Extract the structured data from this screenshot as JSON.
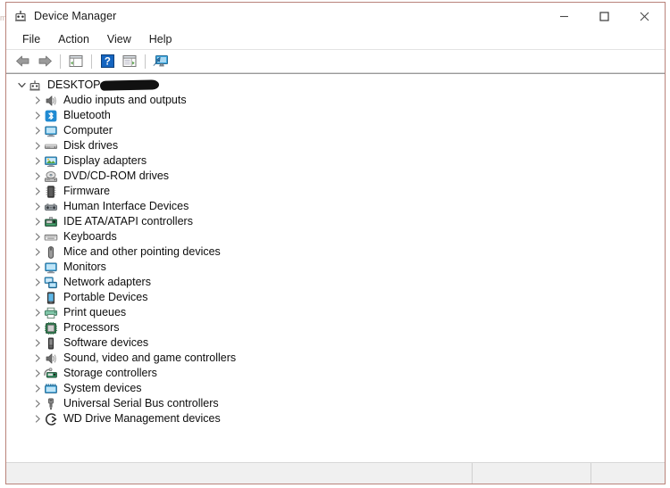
{
  "window": {
    "title": "Device Manager",
    "icon": "device-manager-icon",
    "controls": {
      "minimize": "–",
      "maximize": "☐",
      "close": "✕"
    }
  },
  "menubar": {
    "items": [
      {
        "label": "File"
      },
      {
        "label": "Action"
      },
      {
        "label": "View"
      },
      {
        "label": "Help"
      }
    ]
  },
  "toolbar": {
    "buttons": [
      {
        "name": "back-button",
        "icon": "back-arrow-icon",
        "tooltip": "Back"
      },
      {
        "name": "forward-button",
        "icon": "forward-arrow-icon",
        "tooltip": "Forward"
      },
      {
        "name": "show-hide-console-tree-button",
        "icon": "console-tree-icon",
        "tooltip": "Show/Hide Console Tree"
      },
      {
        "name": "help-button",
        "icon": "help-question-icon",
        "tooltip": "Help"
      },
      {
        "name": "properties-button",
        "icon": "properties-window-icon",
        "tooltip": "Properties"
      },
      {
        "name": "scan-hardware-changes-button",
        "icon": "scan-monitor-icon",
        "tooltip": "Scan for hardware changes"
      }
    ]
  },
  "tree": {
    "root": {
      "label": "DESKTOP",
      "redacted": true,
      "expanded": true,
      "icon": "computer-root-icon"
    },
    "items": [
      {
        "label": "Audio inputs and outputs",
        "icon": "speaker-icon"
      },
      {
        "label": "Bluetooth",
        "icon": "bluetooth-icon"
      },
      {
        "label": "Computer",
        "icon": "monitor-icon"
      },
      {
        "label": "Disk drives",
        "icon": "disk-drive-icon"
      },
      {
        "label": "Display adapters",
        "icon": "display-adapter-icon"
      },
      {
        "label": "DVD/CD-ROM drives",
        "icon": "optical-drive-icon"
      },
      {
        "label": "Firmware",
        "icon": "firmware-chip-icon"
      },
      {
        "label": "Human Interface Devices",
        "icon": "hid-icon"
      },
      {
        "label": "IDE ATA/ATAPI controllers",
        "icon": "ide-controller-icon"
      },
      {
        "label": "Keyboards",
        "icon": "keyboard-icon"
      },
      {
        "label": "Mice and other pointing devices",
        "icon": "mouse-icon"
      },
      {
        "label": "Monitors",
        "icon": "monitor-icon"
      },
      {
        "label": "Network adapters",
        "icon": "network-adapter-icon"
      },
      {
        "label": "Portable Devices",
        "icon": "portable-device-icon"
      },
      {
        "label": "Print queues",
        "icon": "printer-icon"
      },
      {
        "label": "Processors",
        "icon": "processor-icon"
      },
      {
        "label": "Software devices",
        "icon": "software-device-icon"
      },
      {
        "label": "Sound, video and game controllers",
        "icon": "speaker-icon"
      },
      {
        "label": "Storage controllers",
        "icon": "storage-controller-icon"
      },
      {
        "label": "System devices",
        "icon": "system-device-icon"
      },
      {
        "label": "Universal Serial Bus controllers",
        "icon": "usb-icon"
      },
      {
        "label": "WD Drive Management devices",
        "icon": "wd-drive-icon"
      }
    ],
    "collapsed_glyph": "›",
    "expanded_glyph": "⌄"
  },
  "statusbar": {
    "main": "",
    "pane2": "",
    "pane3": ""
  },
  "colors": {
    "window_border": "#b9837a",
    "bluetooth_blue": "#1f8ad2",
    "monitor_blue": "#3ba7e0",
    "accent_green": "#4f9c3f",
    "help_blue": "#1565c0",
    "redaction": "#111111"
  }
}
